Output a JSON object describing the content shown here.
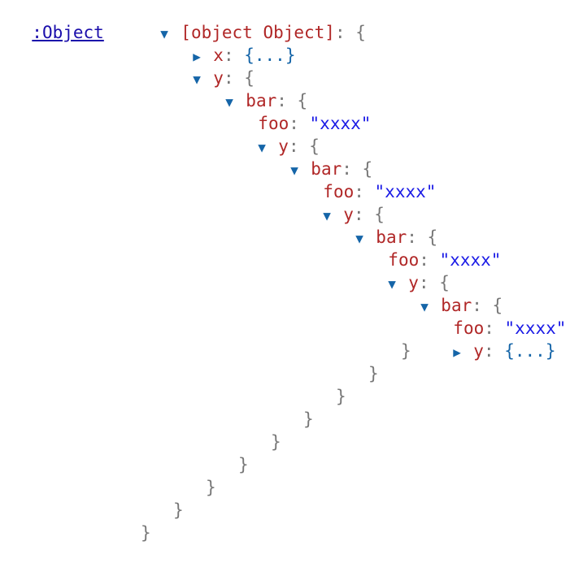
{
  "header": {
    "type_label": ":Object",
    "root_key": "[object Object]"
  },
  "glyphs": {
    "expanded": "▼",
    "collapsed": "▶",
    "colon": ": ",
    "open_brace": "{",
    "close_brace": "}",
    "ellipsis": "{...}"
  },
  "tree": {
    "x_key": "x",
    "y_key": "y",
    "bar_key": "bar",
    "foo_key": "foo",
    "foo_value": "\"xxxx\""
  },
  "colors": {
    "key": "#b02727",
    "string": "#1a1ae6",
    "arrow": "#1565a8",
    "punctuation": "#777777",
    "link": "#1a0dab"
  }
}
